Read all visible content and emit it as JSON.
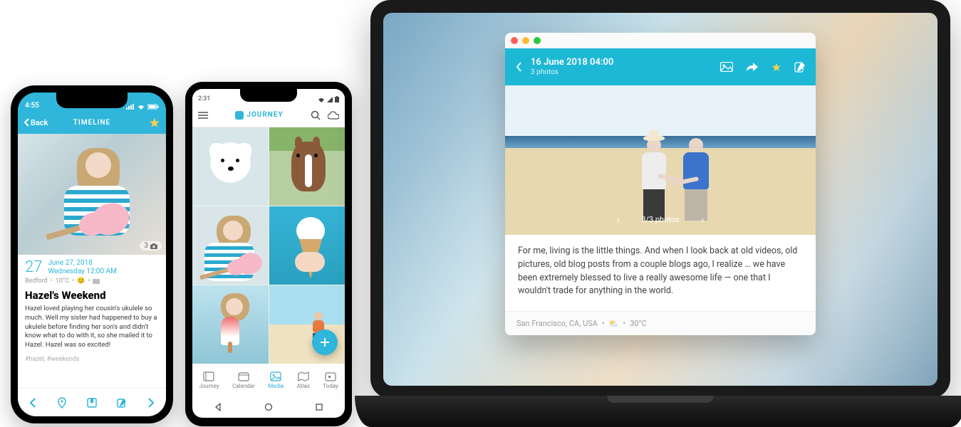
{
  "iphone": {
    "statusbar": {
      "time": "4:55"
    },
    "header": {
      "back_label": "Back",
      "title": "TIMELINE"
    },
    "hero": {
      "photo_count": "3"
    },
    "entry": {
      "day_number": "27",
      "date_line1": "June 27, 2018",
      "date_line2": "Wednesday 12:00 AM",
      "location": "Bedford",
      "temp": "10°C",
      "title": "Hazel's Weekend",
      "body": "Hazel loved playing her cousin's ukulele so much. Well my sister had happened to buy a ukulele before finding her son's and didn't know what to do with it, so she mailed it to Hazel. Hazel was so excited!",
      "tags": "#hazel, #weekends"
    }
  },
  "android": {
    "statusbar": {
      "time": "2:31"
    },
    "header": {
      "brand": "JOURNEY"
    },
    "tabs": {
      "journey": "Journey",
      "calendar": "Calendar",
      "media": "Media",
      "atlas": "Atlas",
      "today": "Today"
    }
  },
  "laptop": {
    "entry": {
      "date": "16 June 2018 04:00",
      "subtitle": "3 photos",
      "photo_counter": "3/3 photos",
      "body": "For me, living is the little things. And when I look back at old videos, old pictures, old blog posts from a couple blogs ago, I realize … we have been extremely blessed to live a really awesome life — one that I wouldn't trade for anything in the world.",
      "footer_location": "San Francisco, CA, USA",
      "footer_temp": "30°C"
    }
  }
}
